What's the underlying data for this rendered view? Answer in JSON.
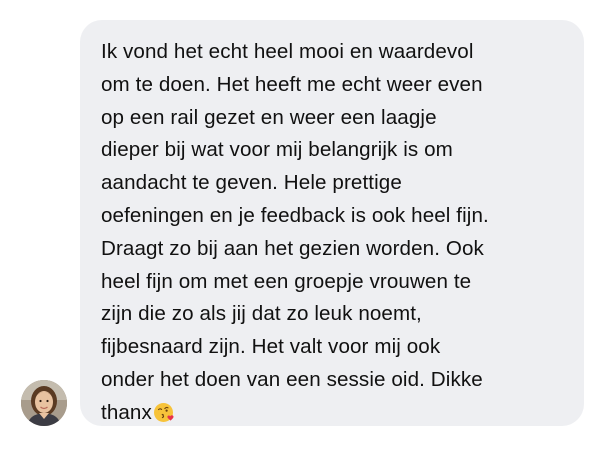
{
  "message": {
    "text": "Ik vond het echt heel mooi en waardevol\nom te doen. Het heeft me echt weer even\nop een rail gezet en weer een laagje\ndieper bij wat voor mij belangrijk is om\naandacht te geven. Hele prettige\noefeningen en je feedback is ook heel fijn.\nDraagt zo bij aan het gezien worden. Ook\nheel fijn om met een groepje vrouwen te\nzijn die zo als jij dat zo leuk noemt,\nfijbesnaard zijn. Het valt voor mij ook\nonder het doen van een sessie oid. Dikke\nthanx",
    "emoji": "face-blowing-a-kiss-icon"
  },
  "colors": {
    "bubble_bg": "#eeeff2",
    "text": "#111111",
    "emoji_face": "#f7c33a",
    "emoji_heart": "#e8324a"
  }
}
